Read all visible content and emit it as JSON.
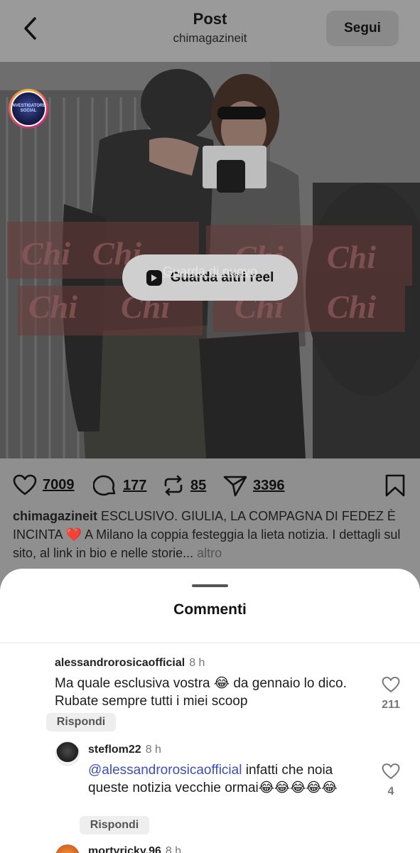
{
  "header": {
    "title": "Post",
    "account": "chimagazineit",
    "follow_label": "Segui"
  },
  "video": {
    "watermark": "Chi",
    "watch_more_label": "Guarda altri reel",
    "rewatch_label": "Guarda di nuovo"
  },
  "actions": {
    "likes": "7009",
    "comments": "177",
    "reposts": "85",
    "shares": "3396"
  },
  "caption": {
    "author": "chimagazineit",
    "text_1": "ESCLUSIVO. GIULIA, LA COMPAGNA DI FEDEZ È INCINTA",
    "emoji": "❤️",
    "text_2": "A Milano la coppia festeggia la lieta notizia. I dettagli sul sito, al link in bio e nelle storie...",
    "more": "altro"
  },
  "sheet": {
    "title": "Commenti"
  },
  "comments": [
    {
      "username": "alessandrorosicaofficial",
      "time": "8 h",
      "avatar_text": "INVESTIGATORE SOCIAL",
      "text": "Ma quale esclusiva vostra 😂 da gennaio lo dico. Rubate sempre tutti i miei scoop",
      "likes": "211",
      "reply_label": "Rispondi"
    },
    {
      "username": "steflom22",
      "time": "8 h",
      "mention": "@alessandrorosicaofficial",
      "text": "infatti che noia queste notizia vecchie ormai😂😂😂😂😂",
      "likes": "4",
      "reply_label": "Rispondi"
    },
    {
      "username": "mortyricky.96",
      "time": "8 h"
    }
  ],
  "colors": {
    "mention": "#3b4fb8",
    "heart_red": "#c21a2c",
    "overlay_grey": "#8f8f8f"
  }
}
